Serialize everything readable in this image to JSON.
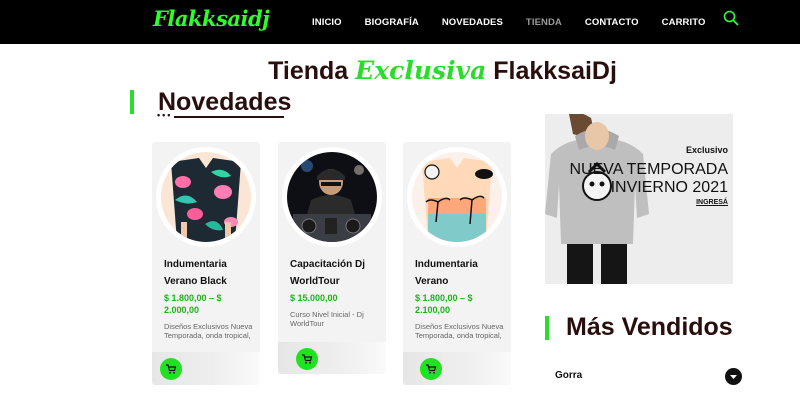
{
  "header": {
    "logo_text": "Flakksaidj",
    "nav": [
      {
        "label": "INICIO",
        "active": false
      },
      {
        "label": "BIOGRAFÍA",
        "active": false
      },
      {
        "label": "NOVEDADES",
        "active": false
      },
      {
        "label": "TIENDA",
        "active": true
      },
      {
        "label": "CONTACTO",
        "active": false
      },
      {
        "label": "CARRITO",
        "active": false
      }
    ],
    "search_icon": "search-icon"
  },
  "page_title": {
    "prefix": "Tienda",
    "accent": "Exclusiva",
    "suffix": "FlakksaiDj"
  },
  "novedades": {
    "heading": "Novedades",
    "dots": "•••",
    "products": [
      {
        "name": "Indumentaria Verano Black",
        "price": "$ 1.800,00 – $ 2.000,00",
        "description": "Diseños Exclusivos Nueva Temporada, onda tropical,",
        "image": "tropical-print-shirt-black"
      },
      {
        "name": "Capacitación Dj WorldTour",
        "price": "$ 15.000,00",
        "description": "Curso Nivel Inicial - Dj WorldTour",
        "image": "dj-at-mixer-photo"
      },
      {
        "name": "Indumentaria Verano",
        "price": "$ 1.800,00 – $ 2.100,00",
        "description": "Diseños Exclusivos Nueva Temporada, onda tropical,",
        "image": "sunset-palm-print-shirt"
      }
    ]
  },
  "promo": {
    "tag": "Exclusivo",
    "headline_line1": "NUEVA TEMPORADA",
    "headline_line2": "INVIERNO 2021",
    "link": "INGRESÁ"
  },
  "mas_vendidos": {
    "heading": "Más Vendidos",
    "dropdown_label": "Gorra"
  },
  "colors": {
    "accent_green": "#2cdc2c",
    "price_green": "#1bb51b",
    "dark_heading": "#2a0e0e",
    "topbar": "#000000"
  }
}
